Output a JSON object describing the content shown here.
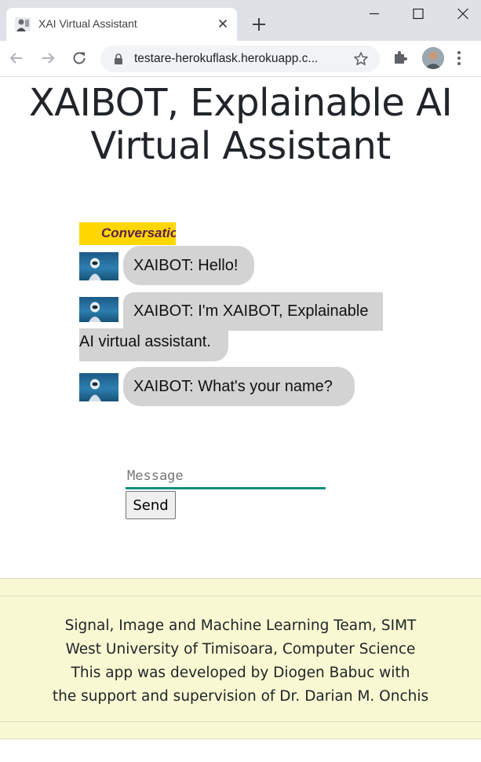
{
  "browser": {
    "tab_title": "XAI Virtual Assistant",
    "url": "testare-herokuflask.herokuapp.c..."
  },
  "page": {
    "heading_line1": "XAIBOT, Explainable AI",
    "heading_line2": "Virtual Assistant",
    "conversation_label": "Conversation",
    "messages": [
      {
        "text": "XAIBOT: Hello!"
      },
      {
        "text_line1": "XAIBOT: I'm XAIBOT, Explainable",
        "text_line2": "AI virtual assistant."
      },
      {
        "text": "XAIBOT: What's your name?"
      }
    ],
    "input": {
      "placeholder": "Message",
      "value": ""
    },
    "send_label": "Send",
    "footer": {
      "line1": "Signal, Image and Machine Learning Team, SIMT",
      "line2": "West University of Timisoara, Computer Science",
      "line3": "This app was developed by Diogen Babuc with",
      "line4": "the support and supervision of Dr. Darian M. Onchis"
    }
  },
  "colors": {
    "accent_underline": "#138e7d",
    "conversation_label_bg": "#ffd700",
    "bubble_bg": "#d3d3d3",
    "footer_bg": "#f8f8d2"
  }
}
